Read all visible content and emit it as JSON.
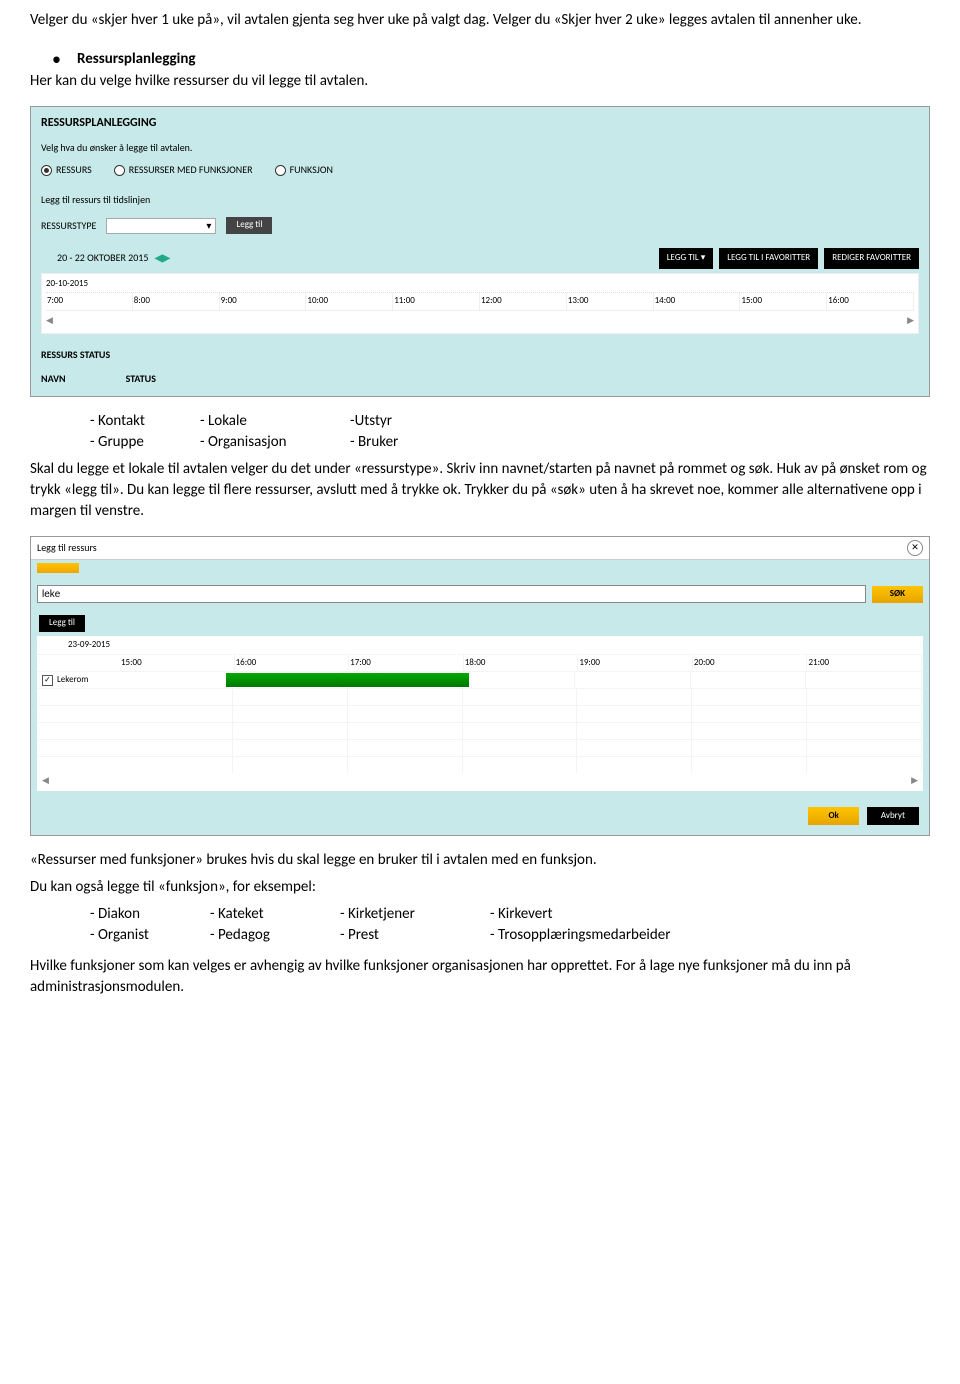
{
  "intro": {
    "p1": "Velger du «skjer hver 1 uke på», vil avtalen gjenta seg hver uke på valgt dag. Velger du «Skjer hver 2 uke» legges avtalen til annenher uke."
  },
  "section1": {
    "title": "Ressursplanlegging",
    "desc": "Her kan du velge hvilke ressurser du vil legge til avtalen."
  },
  "ss1": {
    "title": "RESSURSPLANLEGGING",
    "sub": "Velg hva du ønsker å legge til avtalen.",
    "radio1": "RESSURS",
    "radio2": "RESSURSER MED FUNKSJONER",
    "radio3": "FUNKSJON",
    "subhead": "Legg til ressurs til tidslinjen",
    "label_type": "RESSURSTYPE",
    "btn_legg": "Legg til",
    "daterange": "20 - 22 OKTOBER 2015",
    "tool_legg": "LEGG TIL",
    "tool_fav": "LEGG TIL I FAVORITTER",
    "tool_red": "REDIGER FAVORITTER",
    "date_line": "20-10-2015",
    "hours": [
      "7:00",
      "8:00",
      "9:00",
      "10:00",
      "11:00",
      "12:00",
      "13:00",
      "14:00",
      "15:00",
      "16:00"
    ],
    "status": "RESSURS STATUS",
    "col1": "NAVN",
    "col2": "STATUS"
  },
  "resources": {
    "r1c1": "- Kontakt",
    "r1c2": "- Lokale",
    "r1c3": "-Utstyr",
    "r2c1": "- Gruppe",
    "r2c2": "- Organisasjon",
    "r2c3": "- Bruker"
  },
  "para2": {
    "text": "Skal du legge et lokale til avtalen velger du det under «ressurstype». Skriv inn navnet/starten på navnet på rommet og søk. Huk av på ønsket rom og trykk «legg til». Du kan legge til flere ressurser, avslutt med å trykke ok.  Trykker du på «søk» uten å ha skrevet noe, kommer alle alternativene opp i margen til venstre."
  },
  "ss2": {
    "title": "Legg til ressurs",
    "search_value": "leke",
    "sok": "SØK",
    "leggtil": "Legg til",
    "date": "23-09-2015",
    "hours": [
      "15:00",
      "16:00",
      "17:00",
      "18:00",
      "19:00",
      "20:00",
      "21:00"
    ],
    "rowname": "Lekerom",
    "ok": "Ok",
    "avbryt": "Avbryt"
  },
  "para3": {
    "p1": "«Ressurser med funksjoner» brukes hvis du skal legge en bruker til i avtalen med en funksjon.",
    "p2_lead": "Du kan også legge til «funksjon», for eksempel:"
  },
  "funcs": {
    "r1c1": "- Diakon",
    "r1c2": "- Kateket",
    "r1c3": "- Kirketjener",
    "r1c4": "- Kirkevert",
    "r2c1": "- Organist",
    "r2c2": "- Pedagog",
    "r2c3": "- Prest",
    "r2c4": "- Trosopplæringsmedarbeider"
  },
  "para4": {
    "text": "Hvilke funksjoner som kan velges er avhengig av hvilke funksjoner organisasjonen har opprettet. For å lage nye funksjoner må du inn på administrasjonsmodulen."
  }
}
